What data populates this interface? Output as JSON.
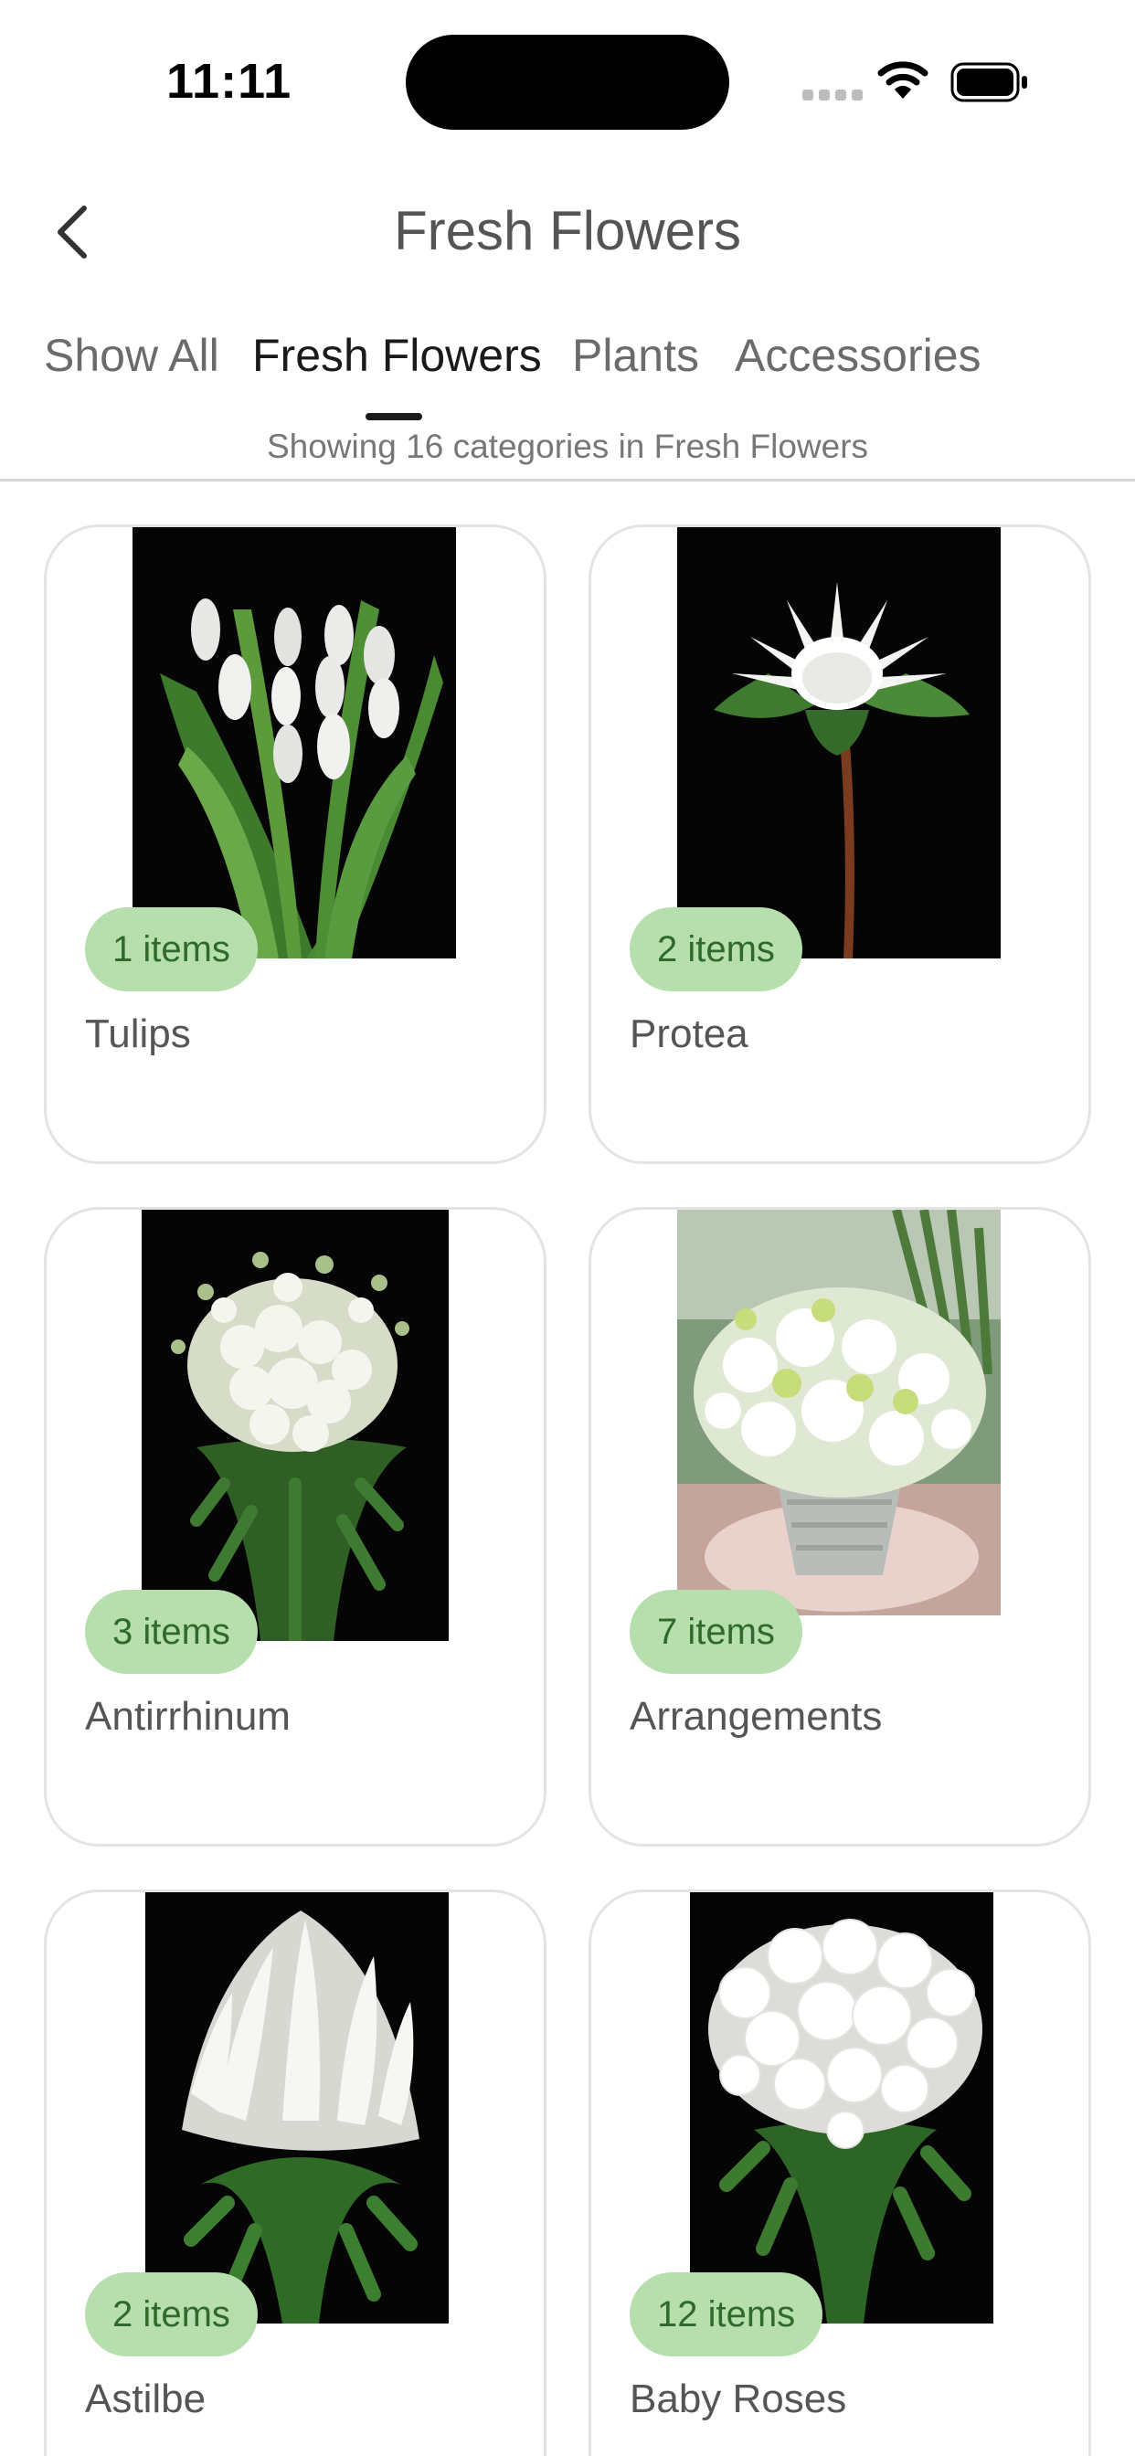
{
  "status_bar": {
    "time": "11:11"
  },
  "header": {
    "title": "Fresh Flowers"
  },
  "tabs": [
    {
      "label": "Show All",
      "active": false
    },
    {
      "label": "Fresh Flowers",
      "active": true
    },
    {
      "label": "Plants",
      "active": false
    },
    {
      "label": "Accessories",
      "active": false
    }
  ],
  "subtitle": "Showing 16 categories in Fresh Flowers",
  "categories": [
    {
      "name": "Tulips",
      "count_label": "1 items"
    },
    {
      "name": "Protea",
      "count_label": "2 items"
    },
    {
      "name": "Antirrhinum",
      "count_label": "3 items"
    },
    {
      "name": "Arrangements",
      "count_label": "7 items"
    },
    {
      "name": "Astilbe",
      "count_label": "2 items"
    },
    {
      "name": "Baby Roses",
      "count_label": "12 items"
    }
  ],
  "colors": {
    "badge_bg": "#b6dfad",
    "badge_text": "#2f6a2c",
    "active_tab": "#1a1a1a",
    "inactive_tab": "#6b6b6b"
  },
  "icons": {
    "back": "chevron-left-icon",
    "wifi": "wifi-icon",
    "battery": "battery-icon",
    "signal": "signal-icon"
  }
}
